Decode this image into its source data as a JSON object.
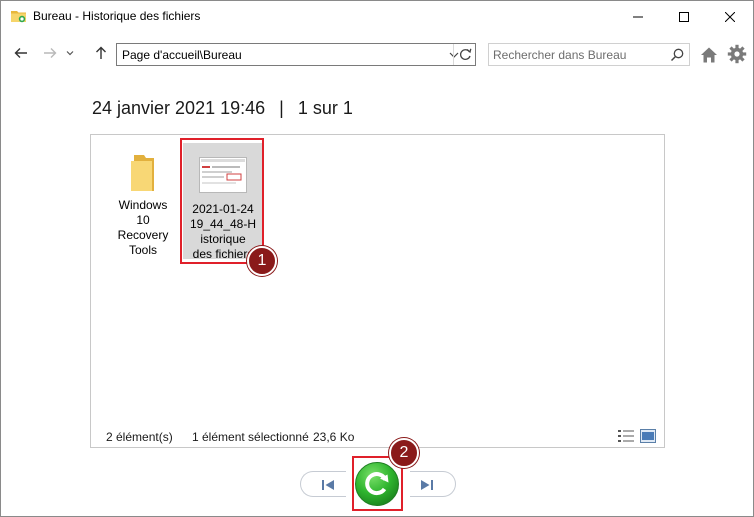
{
  "window": {
    "title": "Bureau - Historique des fichiers"
  },
  "titlebar": {
    "icons": {
      "app": "folder-history-icon",
      "minimize": "minimize-icon",
      "maximize": "maximize-icon",
      "close": "close-icon"
    }
  },
  "navbar": {
    "icons": {
      "back": "arrow-left-icon",
      "forward": "arrow-right-icon",
      "recent": "chevron-down-icon",
      "up": "arrow-up-icon",
      "refresh": "refresh-icon",
      "home": "home-icon",
      "settings": "gear-icon",
      "search": "search-icon"
    },
    "address": "Page d'accueil\\Bureau",
    "search_placeholder": "Rechercher dans Bureau"
  },
  "header": {
    "date": "24 janvier 2021 19:46",
    "separator": "|",
    "position": "1 sur 1"
  },
  "items": [
    {
      "label_lines": [
        "Windows",
        "10",
        "Recovery",
        "Tools"
      ],
      "icon": "folder-icon",
      "selected": false
    },
    {
      "label_lines": [
        "2021-01-24",
        "19_44_48-H",
        "istorique",
        "des fichiers"
      ],
      "icon": "image-file-icon",
      "selected": true
    }
  ],
  "status": {
    "count": "2 élément(s)",
    "selected": "1 élément sélectionné",
    "size": "23,6 Ko"
  },
  "controls": {
    "icons": {
      "previous": "skip-previous-icon",
      "restore": "restore-icon",
      "next": "skip-next-icon"
    }
  },
  "annotations": [
    {
      "number": "1"
    },
    {
      "number": "2"
    }
  ],
  "colors": {
    "highlight": "#e0202a",
    "badge": "#8a1a1a",
    "restore_green": "#2fb52f"
  }
}
